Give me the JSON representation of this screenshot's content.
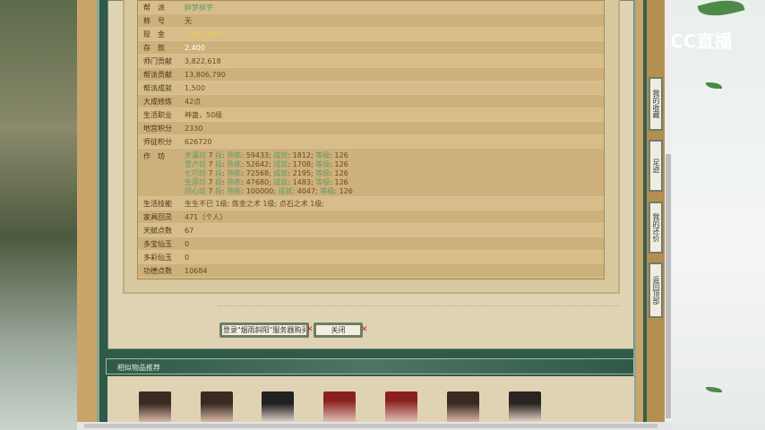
{
  "rows": [
    {
      "label": "帮　派",
      "value": "醉梦枫宇",
      "color": "#5f9a6a"
    },
    {
      "label": "称　号",
      "value": "无"
    },
    {
      "label": "现　金",
      "value": "1,815,540",
      "color": "#f0d040"
    },
    {
      "label": "存　款",
      "value": "2,400",
      "color": "#ffffff"
    },
    {
      "label": "师门贡献",
      "value": "3,822,618"
    },
    {
      "label": "帮派贡献",
      "value": "13,806,790"
    },
    {
      "label": "帮派成就",
      "value": "1,500"
    },
    {
      "label": "大成修炼",
      "value": "42点"
    },
    {
      "label": "生活职业",
      "value": "神蛊，50级"
    },
    {
      "label": "地宫积分",
      "value": "2330"
    },
    {
      "label": "师徒积分",
      "value": "626720"
    }
  ],
  "workshop": {
    "label": "作　坊",
    "items": [
      {
        "name": "步瀛坊",
        "level": "7",
        "lv": "段",
        "f1": "熟练",
        "v1": "59433",
        "f2": "成就",
        "v2": "1812",
        "f3": "等级",
        "v3": "126"
      },
      {
        "name": "雪卢坊",
        "level": "7",
        "lv": "段",
        "f1": "熟练",
        "v1": "52642",
        "f2": "成就",
        "v2": "1708",
        "f3": "等级",
        "v3": "126"
      },
      {
        "name": "七巧坊",
        "level": "7",
        "lv": "段",
        "f1": "熟练",
        "v1": "72568",
        "f2": "成就",
        "v2": "2195",
        "f3": "等级",
        "v3": "126"
      },
      {
        "name": "生莲坊",
        "level": "7",
        "lv": "段",
        "f1": "熟练",
        "v1": "47680",
        "f2": "成就",
        "v2": "1483",
        "f3": "等级",
        "v3": "126"
      },
      {
        "name": "同心坊",
        "level": "7",
        "lv": "段",
        "f1": "熟练",
        "v1": "100000",
        "f2": "成就",
        "v2": "4047",
        "f3": "等级",
        "v3": "126"
      }
    ]
  },
  "rows2": [
    {
      "label": "生活技能",
      "value": "生生不已 1级; 炼金之术 1级; 点石之术 1级;"
    },
    {
      "label": "家具回灵",
      "value": "471（个人）"
    },
    {
      "label": "天赋点数",
      "value": "67"
    },
    {
      "label": "多宝仙玉",
      "value": "0"
    },
    {
      "label": "多彩仙玉",
      "value": "0"
    },
    {
      "label": "功德点数",
      "value": "10684"
    }
  ],
  "buttons": {
    "login": "登录\"烟雨斜阳\"服务器购买",
    "close": "关闭"
  },
  "recommend": {
    "title": "相似物品推荐"
  },
  "sidebar": [
    "我的收藏",
    "足迹",
    "我的还价",
    "返回顶部"
  ],
  "logo": "CC直播"
}
